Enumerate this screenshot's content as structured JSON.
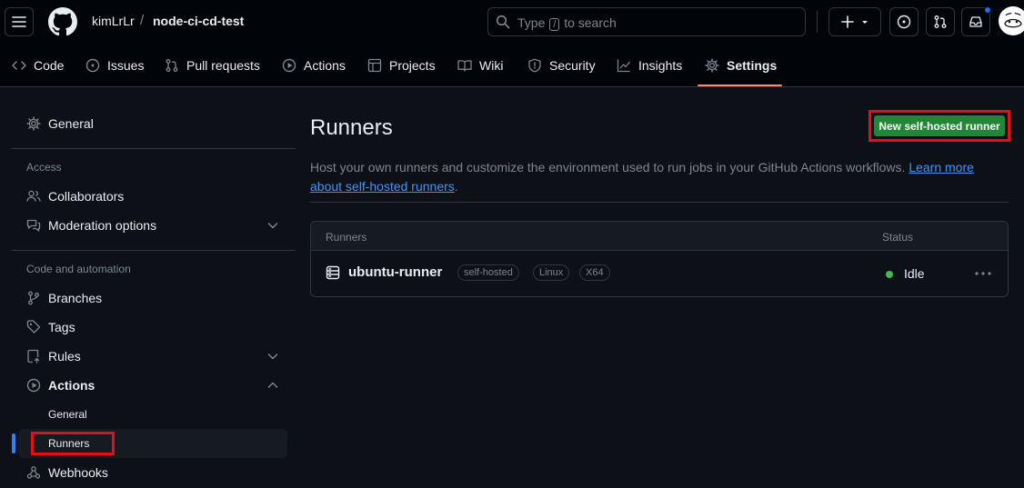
{
  "header": {
    "owner": "kimLrLr",
    "separator": "/",
    "repo": "node-ci-cd-test",
    "search": {
      "prefix": "Type",
      "key": "/",
      "suffix": "to search"
    }
  },
  "repo_nav": {
    "tabs": [
      {
        "label": "Code",
        "icon": "code-icon"
      },
      {
        "label": "Issues",
        "icon": "issue-icon"
      },
      {
        "label": "Pull requests",
        "icon": "pull-request-icon"
      },
      {
        "label": "Actions",
        "icon": "play-icon"
      },
      {
        "label": "Projects",
        "icon": "table-icon"
      },
      {
        "label": "Wiki",
        "icon": "book-icon"
      },
      {
        "label": "Security",
        "icon": "shield-icon"
      },
      {
        "label": "Insights",
        "icon": "graph-icon"
      },
      {
        "label": "Settings",
        "icon": "gear-icon",
        "active": true
      }
    ]
  },
  "sidebar": {
    "general": "General",
    "access_heading": "Access",
    "collaborators": "Collaborators",
    "moderation": "Moderation options",
    "code_heading": "Code and automation",
    "branches": "Branches",
    "tags": "Tags",
    "rules": "Rules",
    "actions": "Actions",
    "actions_general": "General",
    "actions_runners": "Runners",
    "webhooks": "Webhooks"
  },
  "main": {
    "title": "Runners",
    "new_button": "New self-hosted runner",
    "description": "Host your own runners and customize the environment used to run jobs in your GitHub Actions workflows.",
    "learn_more": "Learn more about self-hosted runners",
    "period": ".",
    "table": {
      "col_runners": "Runners",
      "col_status": "Status",
      "rows": [
        {
          "name": "ubuntu-runner",
          "labels": [
            "self-hosted",
            "Linux",
            "X64"
          ],
          "status": "Idle"
        }
      ]
    }
  },
  "colors": {
    "accent_green": "#238636",
    "status_idle": "#3fb950",
    "link": "#4493f8",
    "highlight": "#e3101a"
  }
}
